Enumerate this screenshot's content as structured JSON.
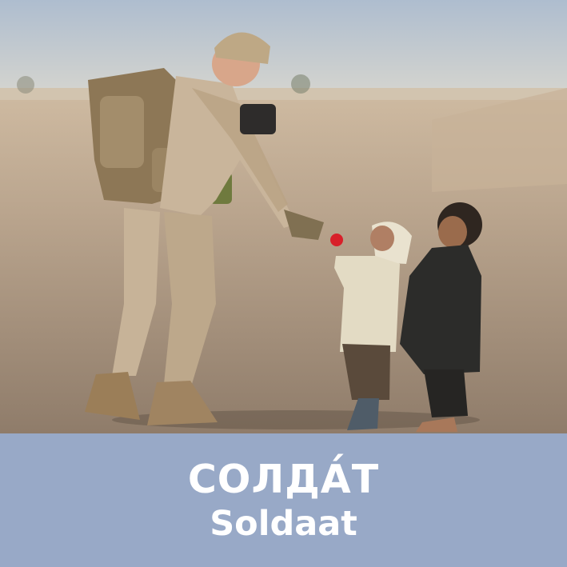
{
  "card": {
    "word_primary": "СОЛДА́Т",
    "word_secondary": "Soldaat"
  },
  "colors": {
    "caption_background": "#98a9c7",
    "caption_text": "#ffffff",
    "sky": "#b9c6d6",
    "ground": "#a8927b"
  },
  "photo": {
    "subjects": [
      "soldier",
      "child-in-white-hood",
      "child-in-dark-clothes",
      "red-ball"
    ]
  }
}
